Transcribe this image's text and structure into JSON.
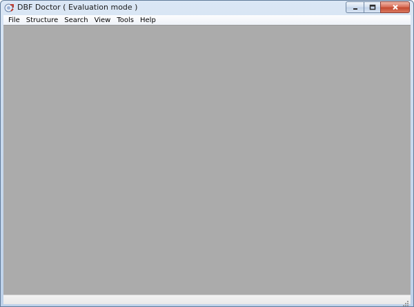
{
  "window": {
    "title": "DBF Doctor ( Evaluation mode )"
  },
  "menu": {
    "items": [
      "File",
      "Structure",
      "Search",
      "View",
      "Tools",
      "Help"
    ]
  },
  "icons": {
    "app": "app-icon",
    "minimize": "minimize-icon",
    "maximize": "maximize-icon",
    "close": "close-icon",
    "grip": "resize-grip-icon"
  },
  "colors": {
    "client_background": "#ababab",
    "close_button": "#c44a31",
    "titlebar": "#c9daee"
  }
}
